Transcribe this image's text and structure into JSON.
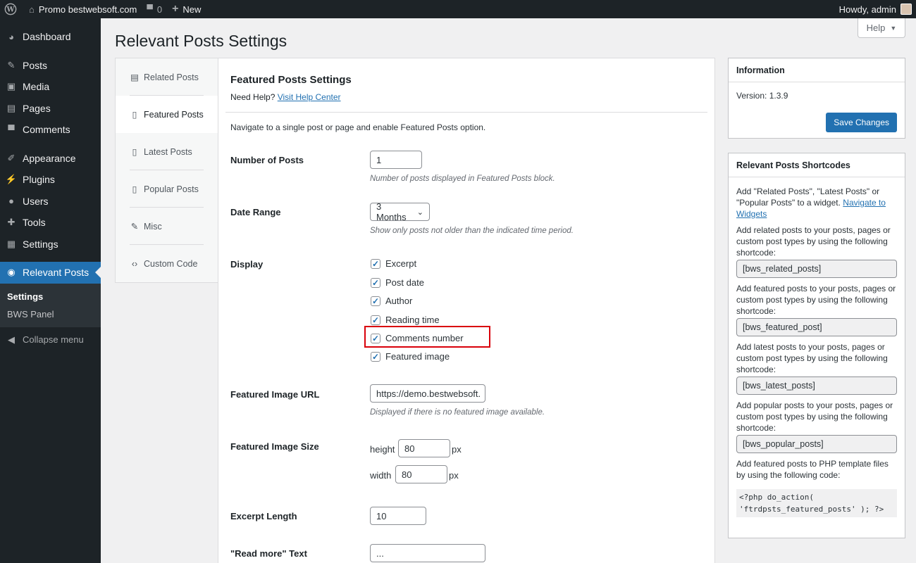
{
  "adminbar": {
    "site_name": "Promo bestwebsoft.com",
    "comments_count": "0",
    "new_label": "New",
    "howdy": "Howdy, admin"
  },
  "menu": {
    "items": [
      {
        "label": "Dashboard",
        "icon": "dashboard-icon"
      },
      {
        "label": "Posts",
        "icon": "pin-icon"
      },
      {
        "label": "Media",
        "icon": "media-icon"
      },
      {
        "label": "Pages",
        "icon": "pages-icon"
      },
      {
        "label": "Comments",
        "icon": "comment-icon"
      },
      {
        "label": "Appearance",
        "icon": "brush-icon"
      },
      {
        "label": "Plugins",
        "icon": "plugin-icon"
      },
      {
        "label": "Users",
        "icon": "user-icon"
      },
      {
        "label": "Tools",
        "icon": "wrench-icon"
      },
      {
        "label": "Settings",
        "icon": "settings-icon"
      }
    ],
    "current": {
      "label": "Relevant Posts",
      "icon": "bws-icon"
    },
    "submenu": [
      "Settings",
      "BWS Panel"
    ],
    "collapse": "Collapse menu"
  },
  "help_label": "Help",
  "page_title": "Relevant Posts Settings",
  "tabs": [
    {
      "label": "Related Posts",
      "icon": "document-icon"
    },
    {
      "label": "Featured Posts",
      "icon": "page-icon"
    },
    {
      "label": "Latest Posts",
      "icon": "page-icon"
    },
    {
      "label": "Popular Posts",
      "icon": "page-icon"
    },
    {
      "label": "Misc",
      "icon": "wrench-icon"
    },
    {
      "label": "Custom Code",
      "icon": "code-icon"
    }
  ],
  "main": {
    "title": "Featured Posts Settings",
    "need_help": "Need Help?",
    "help_link": "Visit Help Center",
    "intro": "Navigate to a single post or page and enable Featured Posts option.",
    "number_of_posts": {
      "label": "Number of Posts",
      "value": "1",
      "desc": "Number of posts displayed in Featured Posts block."
    },
    "date_range": {
      "label": "Date Range",
      "value": "3 Months",
      "desc": "Show only posts not older than the indicated time period."
    },
    "display": {
      "label": "Display",
      "options": [
        "Excerpt",
        "Post date",
        "Author",
        "Reading time",
        "Comments number",
        "Featured image"
      ],
      "checked": [
        true,
        true,
        true,
        true,
        true,
        true
      ]
    },
    "featured_image_url": {
      "label": "Featured Image URL",
      "value": "https://demo.bestwebsoft.",
      "desc": "Displayed if there is no featured image available."
    },
    "featured_image_size": {
      "label": "Featured Image Size",
      "height_label": "height",
      "height": "80",
      "width_label": "width",
      "width": "80",
      "unit": "px"
    },
    "excerpt_length": {
      "label": "Excerpt Length",
      "value": "10"
    },
    "read_more": {
      "label": "\"Read more\" Text",
      "value": "..."
    }
  },
  "info": {
    "title": "Information",
    "version": "Version: 1.3.9",
    "save": "Save Changes"
  },
  "shortcodes": {
    "title": "Relevant Posts Shortcodes",
    "intro": "Add \"Related Posts\", \"Latest Posts\" or \"Popular Posts\" to a widget.",
    "intro_link": "Navigate to Widgets",
    "items": [
      {
        "text": "Add related posts to your posts, pages or custom post types by using the following shortcode:",
        "code": "[bws_related_posts]"
      },
      {
        "text": "Add featured posts to your posts, pages or custom post types by using the following shortcode:",
        "code": "[bws_featured_post]"
      },
      {
        "text": "Add latest posts to your posts, pages or custom post types by using the following shortcode:",
        "code": "[bws_latest_posts]"
      },
      {
        "text": "Add popular posts to your posts, pages or custom post types by using the following shortcode:",
        "code": "[bws_popular_posts]"
      }
    ],
    "php_text": "Add featured posts to PHP template files by using the following code:",
    "php_code": "<?php do_action( 'ftrdpsts_featured_posts' ); ?>"
  }
}
